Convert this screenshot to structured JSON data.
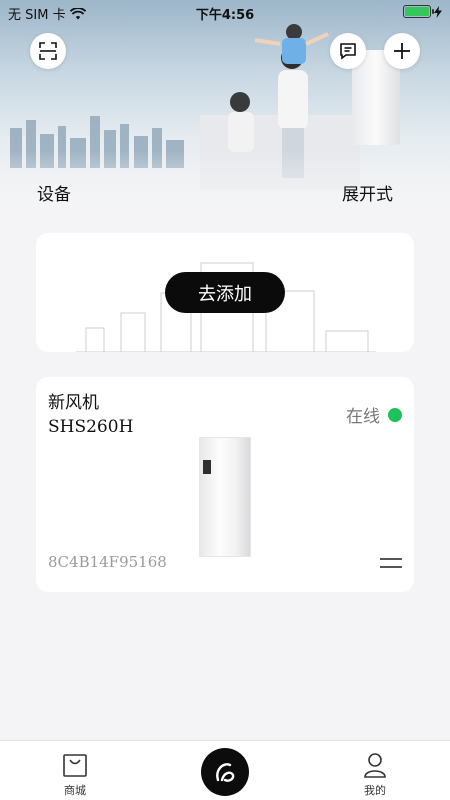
{
  "status_bar": {
    "carrier": "无 SIM 卡",
    "time": "下午4:56",
    "wifi_icon": "wifi-icon",
    "battery_level": 1.0,
    "battery_color": "#35c759"
  },
  "header": {
    "scan_icon": "scan-icon",
    "message_icon": "message-icon",
    "add_icon": "plus-icon"
  },
  "section": {
    "title": "设备",
    "view_mode": "展开式"
  },
  "add_card": {
    "button_label": "去添加"
  },
  "device": {
    "name": "新风机SHS260H",
    "status": "在线",
    "status_color": "#1ec25b",
    "id": "8C4B14F95168"
  },
  "tabbar": {
    "items": [
      {
        "label": "商城",
        "icon": "shopping-bag-icon"
      },
      {
        "label": "",
        "icon": "brand-logo-icon"
      },
      {
        "label": "我的",
        "icon": "user-icon"
      }
    ]
  }
}
